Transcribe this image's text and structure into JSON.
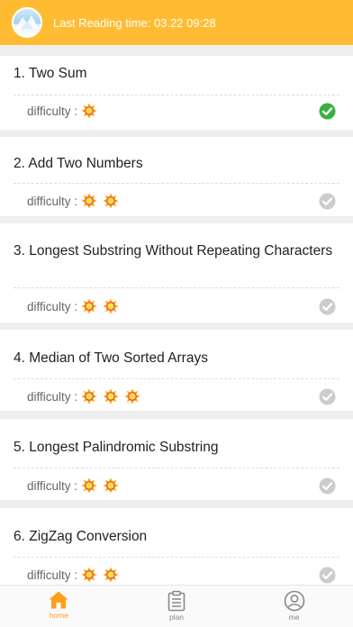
{
  "header": {
    "text": "Last Reading time: 03.22 09:28",
    "background": "#ffbc33"
  },
  "problems": [
    {
      "title": "1. Two Sum",
      "difficulty_label": "difficulty :",
      "difficulty": 1,
      "completed": true
    },
    {
      "title": "2. Add Two Numbers",
      "difficulty_label": "difficulty :",
      "difficulty": 2,
      "completed": false
    },
    {
      "title": "3. Longest Substring Without Repeating Characters",
      "difficulty_label": "difficulty :",
      "difficulty": 2,
      "completed": false
    },
    {
      "title": "4. Median of Two Sorted Arrays",
      "difficulty_label": "difficulty :",
      "difficulty": 3,
      "completed": false
    },
    {
      "title": "5. Longest Palindromic Substring",
      "difficulty_label": "difficulty :",
      "difficulty": 2,
      "completed": false
    },
    {
      "title": "6. ZigZag Conversion",
      "difficulty_label": "difficulty :",
      "difficulty": 2,
      "completed": false
    }
  ],
  "tabs": [
    {
      "label": "home",
      "icon": "home-icon",
      "active": true
    },
    {
      "label": "plan",
      "icon": "clipboard-icon",
      "active": false
    },
    {
      "label": "me",
      "icon": "user-icon",
      "active": false
    }
  ],
  "colors": {
    "accent": "#ff9e1b",
    "completed": "#3cb043",
    "pending": "#cccccc",
    "star": "#ffa000"
  }
}
